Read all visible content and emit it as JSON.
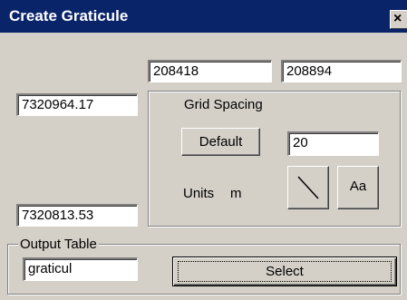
{
  "window": {
    "title": "Create Graticule",
    "close_label": "×"
  },
  "extents": {
    "x_min": "208418",
    "x_max": "208894",
    "y_max": "7320964.17",
    "y_min": "7320813.53"
  },
  "grid_spacing": {
    "caption": "Grid Spacing",
    "default_label": "Default",
    "spacing_value": "20",
    "units_label": "Units",
    "units_value": "m",
    "line_style_icon": "diagonal-line-icon",
    "font_label": "Aa"
  },
  "output_table": {
    "caption": "Output Table",
    "table_name": "graticul",
    "select_label": "Select"
  }
}
